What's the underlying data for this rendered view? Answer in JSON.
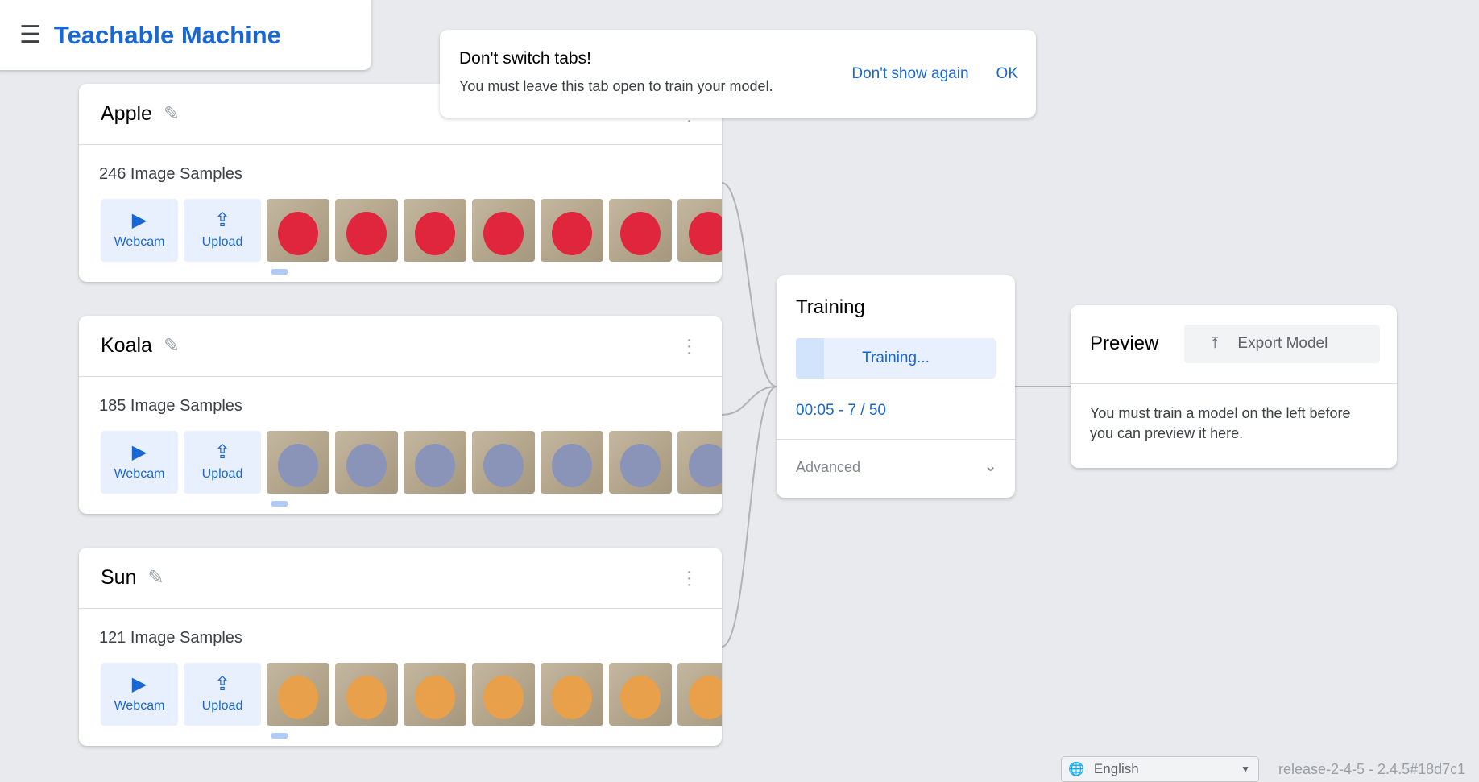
{
  "header": {
    "title": "Teachable Machine"
  },
  "toast": {
    "title": "Don't switch tabs!",
    "message": "You must leave this tab open to train your model.",
    "dont_show": "Don't show again",
    "ok": "OK"
  },
  "classes": [
    {
      "name": "Apple",
      "samples": "246 Image Samples",
      "color": "#e0263d"
    },
    {
      "name": "Koala",
      "samples": "185 Image Samples",
      "color": "#8a94b8"
    },
    {
      "name": "Sun",
      "samples": "121 Image Samples",
      "color": "#e8a04a"
    }
  ],
  "buttons": {
    "webcam": "Webcam",
    "upload": "Upload"
  },
  "training": {
    "title": "Training",
    "button": "Training...",
    "progress": 0.14,
    "time": "00:05 - 7 / 50",
    "advanced": "Advanced"
  },
  "preview": {
    "title": "Preview",
    "export": "Export Model",
    "message": "You must train a model on the left before you can preview it here."
  },
  "footer": {
    "language": "English",
    "release": "release-2-4-5 - 2.4.5#18d7c1"
  }
}
